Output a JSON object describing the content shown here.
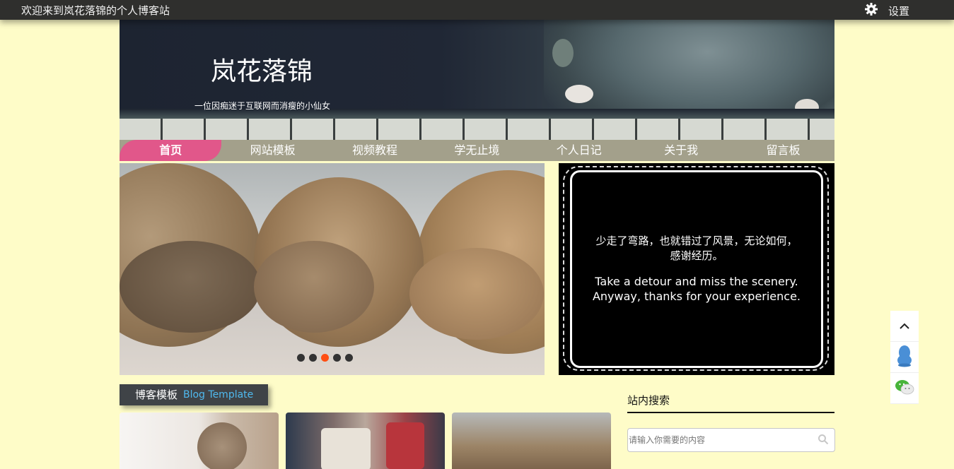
{
  "topbar": {
    "welcome": "欢迎来到岚花落锦的个人博客站",
    "settings_label": "设置",
    "settings_icon": "gear-icon"
  },
  "banner": {
    "title": "岚花落锦",
    "subtitle": "一位因痴迷于互联网而消瘦的小仙女"
  },
  "nav": {
    "items": [
      {
        "label": "首页",
        "active": true
      },
      {
        "label": "网站模板"
      },
      {
        "label": "视频教程"
      },
      {
        "label": "学无止境"
      },
      {
        "label": "个人日记"
      },
      {
        "label": "关于我"
      },
      {
        "label": "留言板"
      }
    ]
  },
  "slider": {
    "dots": 5,
    "active_dot": 3,
    "active_color": "#ff4e12"
  },
  "quote": {
    "cn": "少走了弯路，也就错过了风景，无论如何，感谢经历。",
    "en": "Take a detour and miss the scenery. Anyway, thanks for your experience."
  },
  "section": {
    "title_cn": "博客模板",
    "title_en": "Blog Template"
  },
  "search": {
    "title": "站内搜索",
    "placeholder": "请输入你需要的内容",
    "icon": "search-icon"
  },
  "sidetools": {
    "icons": [
      "chevron-up-icon",
      "qq-icon",
      "wechat-icon"
    ]
  },
  "colors": {
    "background": "#fefcc8",
    "nav_bar": "#a3a08b",
    "nav_active": "#e1578a",
    "accent_blue": "#4fb9ef"
  }
}
